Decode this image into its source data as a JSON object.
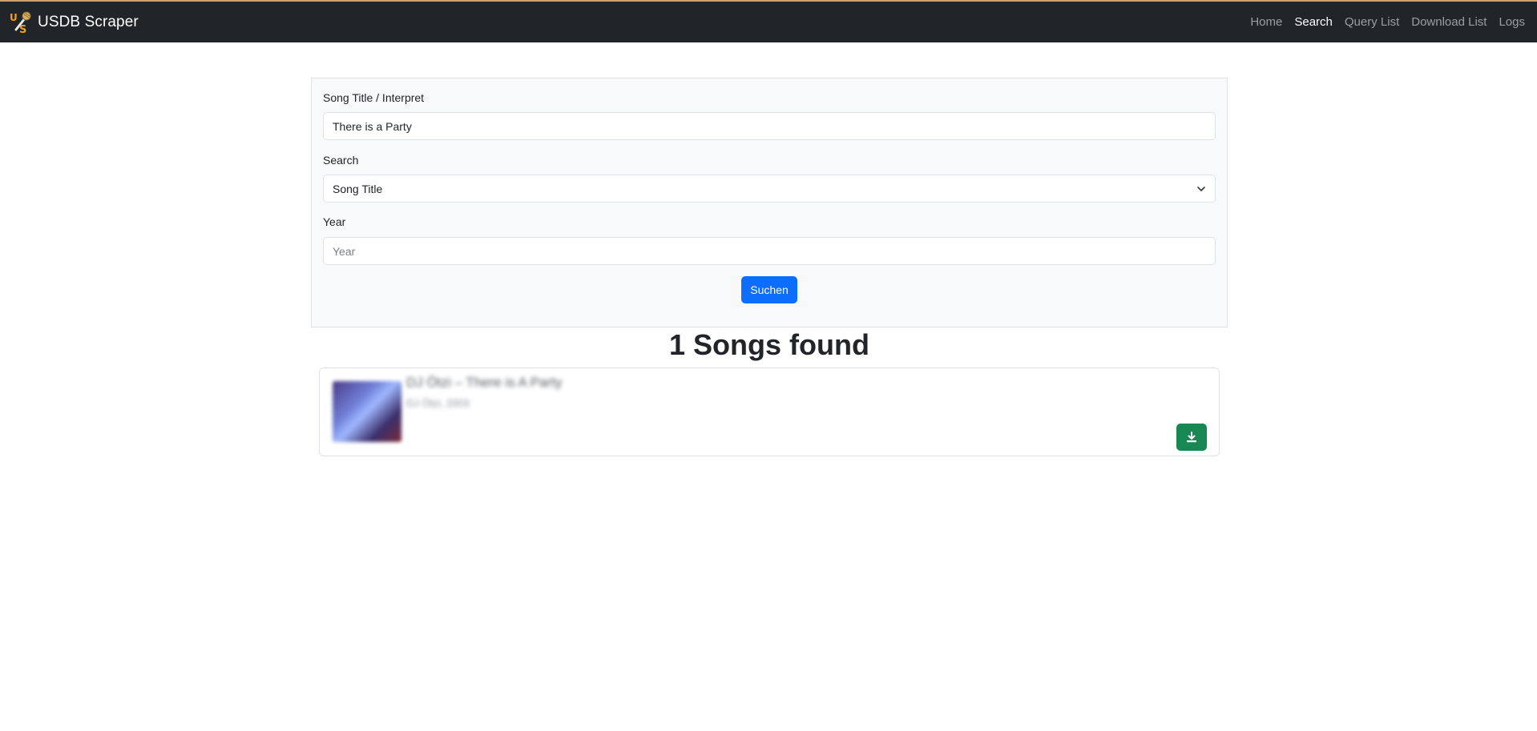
{
  "navbar": {
    "brand": "USDB Scraper",
    "logo_icon": "microphone-us-logo-icon",
    "links": [
      {
        "label": "Home",
        "active": false
      },
      {
        "label": "Search",
        "active": true
      },
      {
        "label": "Query List",
        "active": false
      },
      {
        "label": "Download List",
        "active": false
      },
      {
        "label": "Logs",
        "active": false
      }
    ]
  },
  "search_form": {
    "title_label": "Song Title / Interpret",
    "title_value": "There is a Party",
    "search_label": "Search",
    "search_selected": "Song Title",
    "year_label": "Year",
    "year_value": "",
    "year_placeholder": "Year",
    "submit_label": "Suchen"
  },
  "results": {
    "heading": "1 Songs found",
    "items": [
      {
        "title": "DJ Ötzi – There is A Party",
        "subtitle": "DJ Ötzi, 2003",
        "download_icon": "download-icon"
      }
    ]
  },
  "colors": {
    "navbar_bg": "#212529",
    "accent_line": "#c8a46a",
    "primary": "#0d6efd",
    "success": "#198754"
  }
}
